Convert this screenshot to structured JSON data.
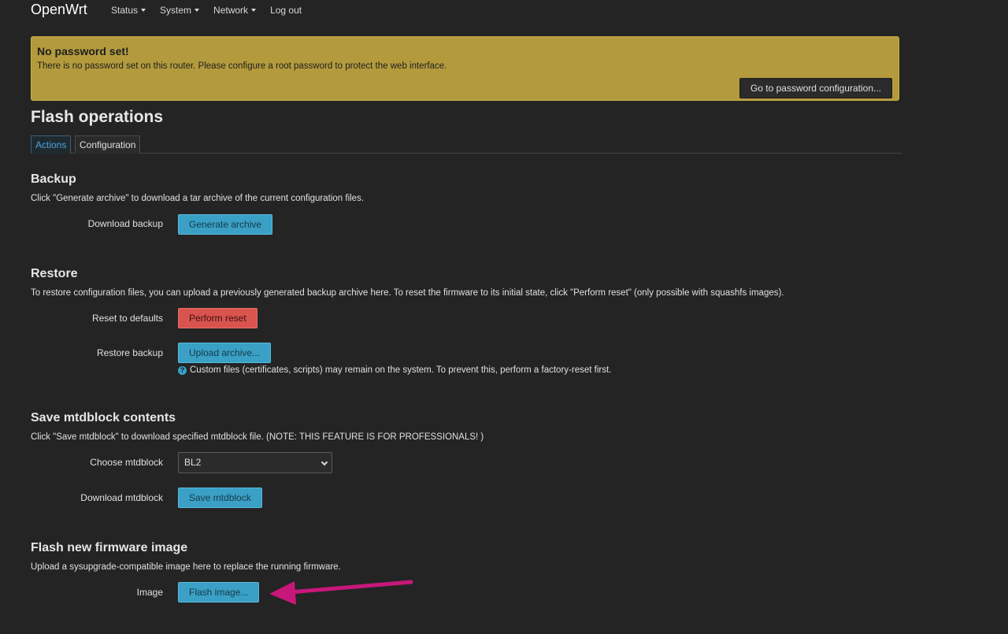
{
  "nav": {
    "brand": "OpenWrt",
    "items": [
      {
        "label": "Status"
      },
      {
        "label": "System"
      },
      {
        "label": "Network"
      },
      {
        "label": "Log out"
      }
    ]
  },
  "alert": {
    "title": "No password set!",
    "text": "There is no password set on this router. Please configure a root password to protect the web interface.",
    "button": "Go to password configuration..."
  },
  "page": {
    "title": "Flash operations",
    "tabs": [
      {
        "label": "Actions",
        "active": true
      },
      {
        "label": "Configuration",
        "active": false
      }
    ]
  },
  "backup": {
    "title": "Backup",
    "desc": "Click \"Generate archive\" to download a tar archive of the current configuration files.",
    "label": "Download backup",
    "button": "Generate archive"
  },
  "restore": {
    "title": "Restore",
    "desc": "To restore configuration files, you can upload a previously generated backup archive here. To reset the firmware to its initial state, click \"Perform reset\" (only possible with squashfs images).",
    "reset_label": "Reset to defaults",
    "reset_button": "Perform reset",
    "restore_label": "Restore backup",
    "restore_button": "Upload archive...",
    "hint": "Custom files (certificates, scripts) may remain on the system. To prevent this, perform a factory-reset first."
  },
  "mtdblock": {
    "title": "Save mtdblock contents",
    "desc": "Click \"Save mtdblock\" to download specified mtdblock file. (NOTE: THIS FEATURE IS FOR PROFESSIONALS! )",
    "choose_label": "Choose mtdblock",
    "selected": "BL2",
    "download_label": "Download mtdblock",
    "download_button": "Save mtdblock"
  },
  "flash": {
    "title": "Flash new firmware image",
    "desc": "Upload a sysupgrade-compatible image here to replace the running firmware.",
    "label": "Image",
    "button": "Flash image..."
  },
  "colors": {
    "background": "#242424",
    "alert": "#b39b3d",
    "primary_button": "#3aa0c5",
    "danger_button": "#d9534f",
    "annotation_arrow": "#c8177a"
  }
}
